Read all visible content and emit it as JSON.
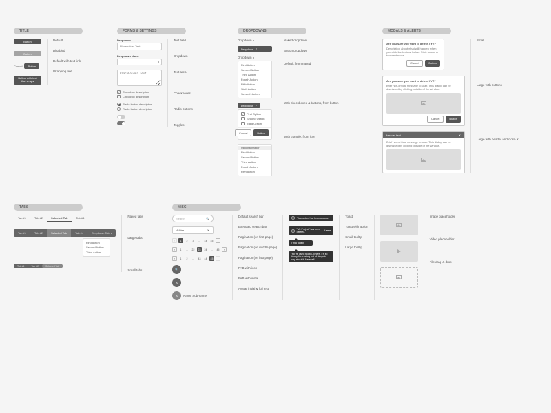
{
  "sections": {
    "title": {
      "heading": "TITLE",
      "labels": [
        "Default",
        "Disabled",
        "Default with text link",
        "Wrapping text"
      ],
      "buttons": {
        "primary": "Button",
        "cancel": "Cancel",
        "wrap": "Button with text that wraps"
      }
    },
    "forms": {
      "heading": "FORMS & SETTINGS",
      "labels": [
        "Text field",
        "Dropdown",
        "Text area",
        "Checkboxes",
        "Radio buttons",
        "Toggles"
      ],
      "dropdown_label": "Dropdown",
      "dropdown_name_label": "Dropdown Name",
      "placeholder": "Placeholder Text",
      "checkbox_desc": "Checkbox description",
      "radio_desc": "Radio button description"
    },
    "dropdowns": {
      "heading": "DROPDOWNS",
      "labels": [
        "Naked dropdown",
        "Button dropdown",
        "Default, from naked",
        "With checkboxes & buttons, from button",
        "With triangle, from icon"
      ],
      "dd_btn": "Dropdown",
      "actions": [
        "First Action",
        "Second Action",
        "Third Action",
        "Fourth Action",
        "Fifth Action",
        "Sixth Action",
        "Seventh Action"
      ],
      "options": [
        "First Option",
        "Second Option",
        "Third Option"
      ],
      "optional_header": "Optional header",
      "cancel": "Cancel",
      "button": "Button"
    },
    "modals": {
      "heading": "MODALS & ALERTS",
      "labels": [
        "Small",
        "Large with buttons",
        "Large with header and close X"
      ],
      "title": "Are you sure you want to delete XYZ?",
      "small_body": "Description about what will happen when you click the buttons below. Stick to one or two sentences.",
      "large_body": "Brief non-critical message to user. This dialog can be dismissed by clicking outside of the window.",
      "header_text": "Header text",
      "cancel": "Cancel",
      "button": "Button"
    },
    "tabs": {
      "heading": "TABS",
      "labels": [
        "Naked tabs",
        "Large tabs",
        "Small tabs"
      ],
      "naked": [
        "Tab #1",
        "Tab #2",
        "Selected Tab",
        "Tab #4"
      ],
      "large": [
        "Tab #1",
        "Tab #2",
        "Selected Tab",
        "Tab #4",
        "Dropdown Tab"
      ],
      "dd_items": [
        "First Action",
        "Second Action",
        "Third Action"
      ],
      "small": [
        "Tab #1",
        "Tab #2",
        "Selected Tab"
      ]
    },
    "misc": {
      "heading": "MISC",
      "labels": [
        "Default search bar",
        "Executed search bar",
        "Pagination (on first page)",
        "Pagination (on middle page)",
        "Pagination (on last page)",
        "FAB with icon",
        "FAB with initial",
        "Avatar initial & full text"
      ],
      "labels2": [
        "Toast",
        "Toast with action",
        "Small tooltip",
        "Large tooltip"
      ],
      "labels3": [
        "Image placeholder",
        "Video placeholder",
        "File drag & drop"
      ],
      "search_ph": "Search",
      "search_val": "A filter",
      "avatar_name": "Name Sub-name",
      "avatar_initial": "A",
      "fab_initial": "A",
      "toast1": "Your action has been undone.",
      "toast2": "\"My Project\" has been deleted.",
      "undo": "Undo",
      "tooltip_sm": "I'm a tooltip",
      "tooltip_lg": "You're using tooltip-lg here. It's so funny I'm running out of things to say about it. Farewell.",
      "pages": [
        "1",
        "2",
        "3",
        "…",
        "44",
        "45"
      ],
      "pages_mid": [
        "1",
        "…",
        "22",
        "23",
        "24",
        "…",
        "45"
      ],
      "pages_last": [
        "1",
        "2",
        "…",
        "43",
        "44",
        "45"
      ]
    }
  }
}
